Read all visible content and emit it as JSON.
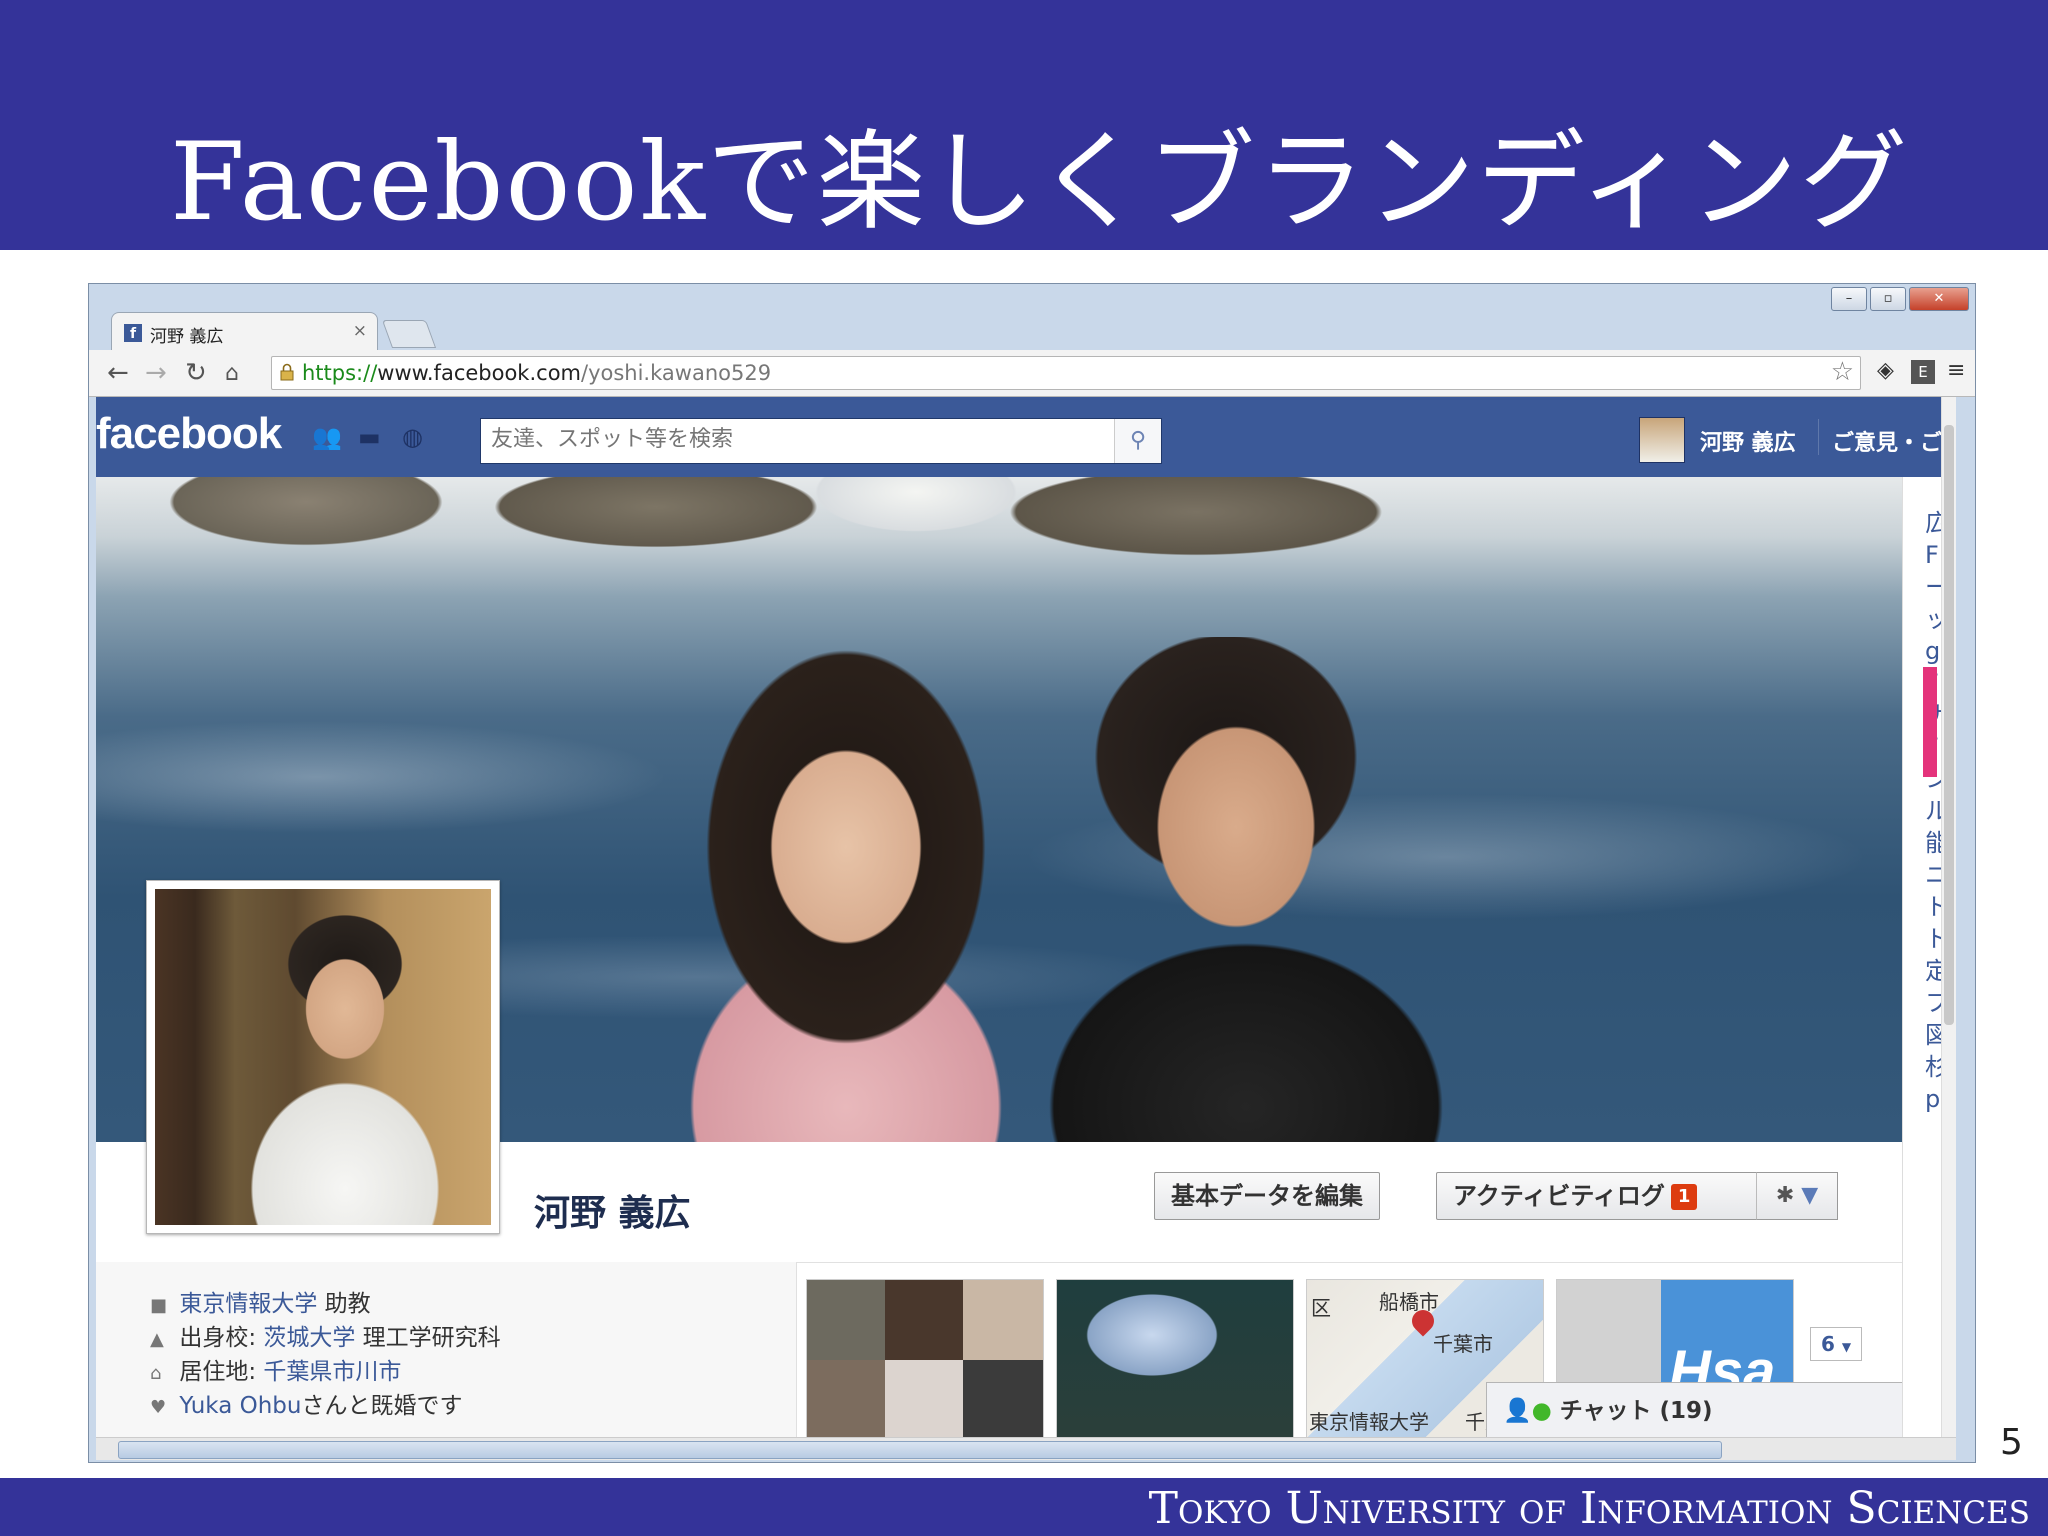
{
  "slide": {
    "title": "Facebookで楽しくブランディング",
    "footer": "Tokyo University of Information Sciences",
    "page_number": "5"
  },
  "window": {
    "controls": [
      "–",
      "▫",
      "✕"
    ]
  },
  "browser": {
    "tab_title": "河野 義広",
    "tab_close": "×",
    "url_scheme": "https://",
    "url_domain": "www.facebook.com",
    "url_path": "/yoshi.kawano529",
    "icons": [
      "back-icon",
      "forward-icon",
      "reload-icon",
      "home-icon",
      "lock-icon",
      "star-icon",
      "buffer-icon",
      "evernote-icon",
      "menu-icon"
    ]
  },
  "facebook": {
    "logo": "facebook",
    "search_placeholder": "友達、スポット等を検索",
    "user_name": "河野 義広",
    "feedback_link": "ご意見・ご",
    "profile_name": "河野 義広",
    "edit_button": "基本データを編集",
    "activity_button": "アクティビティログ",
    "activity_badge": "1",
    "about": [
      {
        "icon": "work-icon",
        "text_link": "東京情報大学",
        "text_after": " 助教"
      },
      {
        "icon": "education-icon",
        "text_before": "出身校: ",
        "text_link": "茨城大学",
        "text_after": " 理工学研究科"
      },
      {
        "icon": "home-icon",
        "text_before": "居住地: ",
        "text_link": "千葉県市川市",
        "text_after": ""
      },
      {
        "icon": "heart-icon",
        "text_link": "Yuka Ohbu",
        "text_after": "さんと既婚です"
      }
    ],
    "map_labels": [
      "船橋市",
      "千葉市",
      "東京情報大学",
      "千葉",
      "区"
    ],
    "hsa_label": "Hsa",
    "more_count": "6",
    "chat_label": "チャット",
    "chat_count": "(19)",
    "ad_column_chars": "広Fーッg F ナFンル能ニトト定フ図杉p"
  }
}
